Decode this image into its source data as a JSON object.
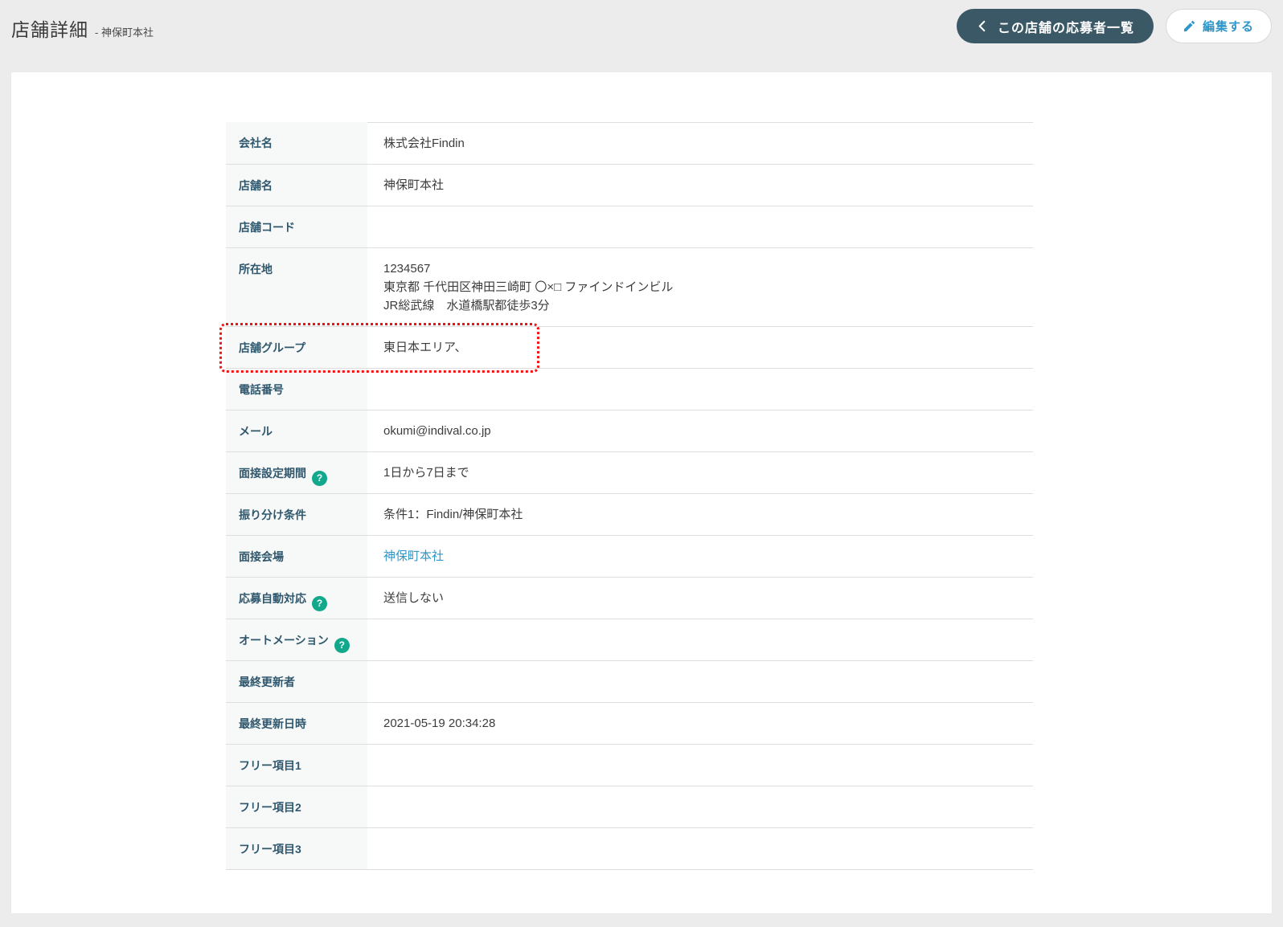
{
  "page": {
    "title": "店舗詳細",
    "subtitle": "- 神保町本社"
  },
  "toolbar": {
    "applicants_button_label": "この店舗の応募者一覧",
    "edit_button_label": "編集する"
  },
  "icons": {
    "chevron_left": "chevron-left-icon",
    "pencil": "pencil-icon",
    "help": "question-mark-icon"
  },
  "colors": {
    "page_background": "#ececed",
    "card_background": "#ffffff",
    "dark_button": "#3b5866",
    "link_blue": "#2e96c8",
    "help_green": "#12a88b",
    "highlight_red": "#f51111",
    "label_text": "#2f586e",
    "row_border": "#dedede",
    "label_cell_background": "#f7f8f8"
  },
  "detail_table": {
    "rows": [
      {
        "label": "会社名",
        "values": [
          "株式会社Findin"
        ]
      },
      {
        "label": "店舗名",
        "values": [
          "神保町本社"
        ]
      },
      {
        "label": "店舗コード",
        "values": []
      },
      {
        "label": "所在地",
        "values": [
          "1234567",
          "東京都 千代田区神田三崎町 〇×□ ファインドインビル",
          "JR総武線　水道橋駅都徒歩3分"
        ]
      },
      {
        "label": "店舗グループ",
        "values": [
          "東日本エリア、"
        ],
        "highlighted": true
      },
      {
        "label": "電話番号",
        "values": []
      },
      {
        "label": "メール",
        "values": [
          "okumi@indival.co.jp"
        ]
      },
      {
        "label": "面接設定期間",
        "values": [
          "1日から7日まで"
        ],
        "help_icon": true
      },
      {
        "label": "振り分け条件",
        "values": [
          "条件1：Findin/神保町本社"
        ]
      },
      {
        "label": "面接会場",
        "values": [
          "神保町本社"
        ],
        "link": true
      },
      {
        "label": "応募自動対応",
        "values": [
          "送信しない"
        ],
        "help_icon": true
      },
      {
        "label": "オートメーション",
        "values": [],
        "help_icon": true
      },
      {
        "label": "最終更新者",
        "values": []
      },
      {
        "label": "最終更新日時",
        "values": [
          "2021-05-19 20:34:28"
        ]
      },
      {
        "label": "フリー項目1",
        "values": []
      },
      {
        "label": "フリー項目2",
        "values": []
      },
      {
        "label": "フリー項目3",
        "values": []
      }
    ]
  }
}
